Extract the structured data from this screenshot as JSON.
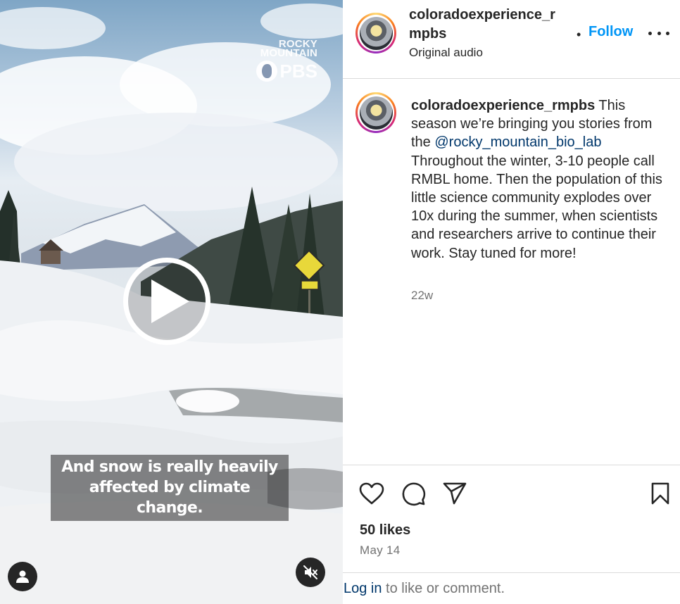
{
  "video": {
    "watermark_line1": "ROCKY",
    "watermark_line2": "MOUNTAIN",
    "watermark_brand": "PBS",
    "caption_line1": "And snow is really heavily",
    "caption_line2": "affected by climate change."
  },
  "header": {
    "username": "coloradoexperience_rmpbs",
    "separator": "•",
    "follow_label": "Follow",
    "audio_label": "Original audio"
  },
  "post": {
    "username": "coloradoexperience_rmpbs",
    "text_before_mention": " This season we’re bringing you stories from the ",
    "mention": "@rocky_mountain_bio_lab",
    "text_after_mention": " Throughout the winter, 3-10 people call RMBL home. Then the population of this little science community explodes over 10x during the summer, when scientists and researchers arrive to continue their work. Stay tuned for more!",
    "time_ago": "22w"
  },
  "actions": {
    "likes": "50 likes",
    "date": "May 14"
  },
  "login": {
    "link": "Log in",
    "rest": " to like or comment."
  },
  "icons": [
    "play-icon",
    "user-icon",
    "mute-icon",
    "more-icon",
    "heart-icon",
    "comment-icon",
    "share-icon",
    "bookmark-icon"
  ],
  "colors": {
    "accent": "#0095f6",
    "link": "#00376b",
    "muted": "#737373",
    "text": "#262626"
  }
}
